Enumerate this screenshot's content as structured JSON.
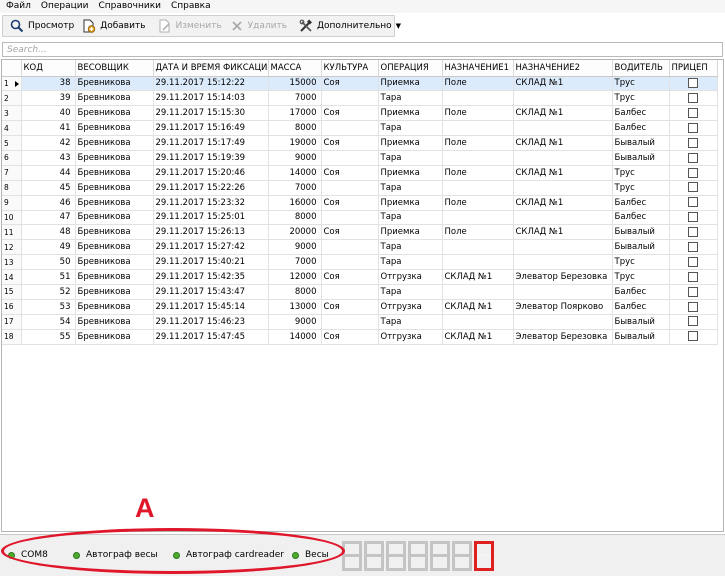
{
  "menu": [
    "Файл",
    "Операции",
    "Справочники",
    "Справка"
  ],
  "toolbar": {
    "view": "Просмотр",
    "add": "Добавить",
    "edit": "Изменить",
    "delete": "Удалить",
    "more": "Дополнительно"
  },
  "search": {
    "placeholder": "Search..."
  },
  "columns": [
    "КОД",
    "ВЕСОВЩИК",
    "ДАТА И ВРЕМЯ ФИКСАЦИИ",
    "МАССА",
    "КУЛЬТУРА",
    "ОПЕРАЦИЯ",
    "НАЗНАЧЕНИЕ1",
    "НАЗНАЧЕНИЕ2",
    "ВОДИТЕЛЬ",
    "ПРИЦЕП"
  ],
  "rows": [
    {
      "n": "1",
      "code": "38",
      "weigher": "Бревникова",
      "dt": "29.11.2017 15:12:22",
      "mass": "15000",
      "crop": "Соя",
      "op": "Приемка",
      "d1": "Поле",
      "d2": "СКЛАД №1",
      "driver": "Трус"
    },
    {
      "n": "2",
      "code": "39",
      "weigher": "Бревникова",
      "dt": "29.11.2017 15:14:03",
      "mass": "7000",
      "crop": "",
      "op": "Тара",
      "d1": "",
      "d2": "",
      "driver": "Трус"
    },
    {
      "n": "3",
      "code": "40",
      "weigher": "Бревникова",
      "dt": "29.11.2017 15:15:30",
      "mass": "17000",
      "crop": "Соя",
      "op": "Приемка",
      "d1": "Поле",
      "d2": "СКЛАД №1",
      "driver": "Балбес"
    },
    {
      "n": "4",
      "code": "41",
      "weigher": "Бревникова",
      "dt": "29.11.2017 15:16:49",
      "mass": "8000",
      "crop": "",
      "op": "Тара",
      "d1": "",
      "d2": "",
      "driver": "Балбес"
    },
    {
      "n": "5",
      "code": "42",
      "weigher": "Бревникова",
      "dt": "29.11.2017 15:17:49",
      "mass": "19000",
      "crop": "Соя",
      "op": "Приемка",
      "d1": "Поле",
      "d2": "СКЛАД №1",
      "driver": "Бывалый"
    },
    {
      "n": "6",
      "code": "43",
      "weigher": "Бревникова",
      "dt": "29.11.2017 15:19:39",
      "mass": "9000",
      "crop": "",
      "op": "Тара",
      "d1": "",
      "d2": "",
      "driver": "Бывалый"
    },
    {
      "n": "7",
      "code": "44",
      "weigher": "Бревникова",
      "dt": "29.11.2017 15:20:46",
      "mass": "14000",
      "crop": "Соя",
      "op": "Приемка",
      "d1": "Поле",
      "d2": "СКЛАД №1",
      "driver": "Трус"
    },
    {
      "n": "8",
      "code": "45",
      "weigher": "Бревникова",
      "dt": "29.11.2017 15:22:26",
      "mass": "7000",
      "crop": "",
      "op": "Тара",
      "d1": "",
      "d2": "",
      "driver": "Трус"
    },
    {
      "n": "9",
      "code": "46",
      "weigher": "Бревникова",
      "dt": "29.11.2017 15:23:32",
      "mass": "16000",
      "crop": "Соя",
      "op": "Приемка",
      "d1": "Поле",
      "d2": "СКЛАД №1",
      "driver": "Балбес"
    },
    {
      "n": "10",
      "code": "47",
      "weigher": "Бревникова",
      "dt": "29.11.2017 15:25:01",
      "mass": "8000",
      "crop": "",
      "op": "Тара",
      "d1": "",
      "d2": "",
      "driver": "Балбес"
    },
    {
      "n": "11",
      "code": "48",
      "weigher": "Бревникова",
      "dt": "29.11.2017 15:26:13",
      "mass": "20000",
      "crop": "Соя",
      "op": "Приемка",
      "d1": "Поле",
      "d2": "СКЛАД №1",
      "driver": "Бывалый"
    },
    {
      "n": "12",
      "code": "49",
      "weigher": "Бревникова",
      "dt": "29.11.2017 15:27:42",
      "mass": "9000",
      "crop": "",
      "op": "Тара",
      "d1": "",
      "d2": "",
      "driver": "Бывалый"
    },
    {
      "n": "13",
      "code": "50",
      "weigher": "Бревникова",
      "dt": "29.11.2017 15:40:21",
      "mass": "7000",
      "crop": "",
      "op": "Тара",
      "d1": "",
      "d2": "",
      "driver": "Трус"
    },
    {
      "n": "14",
      "code": "51",
      "weigher": "Бревникова",
      "dt": "29.11.2017 15:42:35",
      "mass": "12000",
      "crop": "Соя",
      "op": "Отгрузка",
      "d1": "СКЛАД №1",
      "d2": "Элеватор Березовка",
      "driver": "Трус"
    },
    {
      "n": "15",
      "code": "52",
      "weigher": "Бревникова",
      "dt": "29.11.2017 15:43:47",
      "mass": "8000",
      "crop": "",
      "op": "Тара",
      "d1": "",
      "d2": "",
      "driver": "Балбес"
    },
    {
      "n": "16",
      "code": "53",
      "weigher": "Бревникова",
      "dt": "29.11.2017 15:45:14",
      "mass": "13000",
      "crop": "Соя",
      "op": "Отгрузка",
      "d1": "СКЛАД №1",
      "d2": "Элеватор Поярково",
      "driver": "Балбес"
    },
    {
      "n": "17",
      "code": "54",
      "weigher": "Бревникова",
      "dt": "29.11.2017 15:46:23",
      "mass": "9000",
      "crop": "",
      "op": "Тара",
      "d1": "",
      "d2": "",
      "driver": "Бывалый"
    },
    {
      "n": "18",
      "code": "55",
      "weigher": "Бревникова",
      "dt": "29.11.2017 15:47:45",
      "mass": "14000",
      "crop": "Соя",
      "op": "Отгрузка",
      "d1": "СКЛАД №1",
      "d2": "Элеватор Березовка",
      "driver": "Бывалый"
    }
  ],
  "status": {
    "items": [
      "COM8",
      "Автограф весы",
      "Автограф cardreader",
      "Весы"
    ],
    "indicator_color": "#4caa2f"
  },
  "annotation": {
    "label": "A",
    "color": "#e0162b"
  }
}
